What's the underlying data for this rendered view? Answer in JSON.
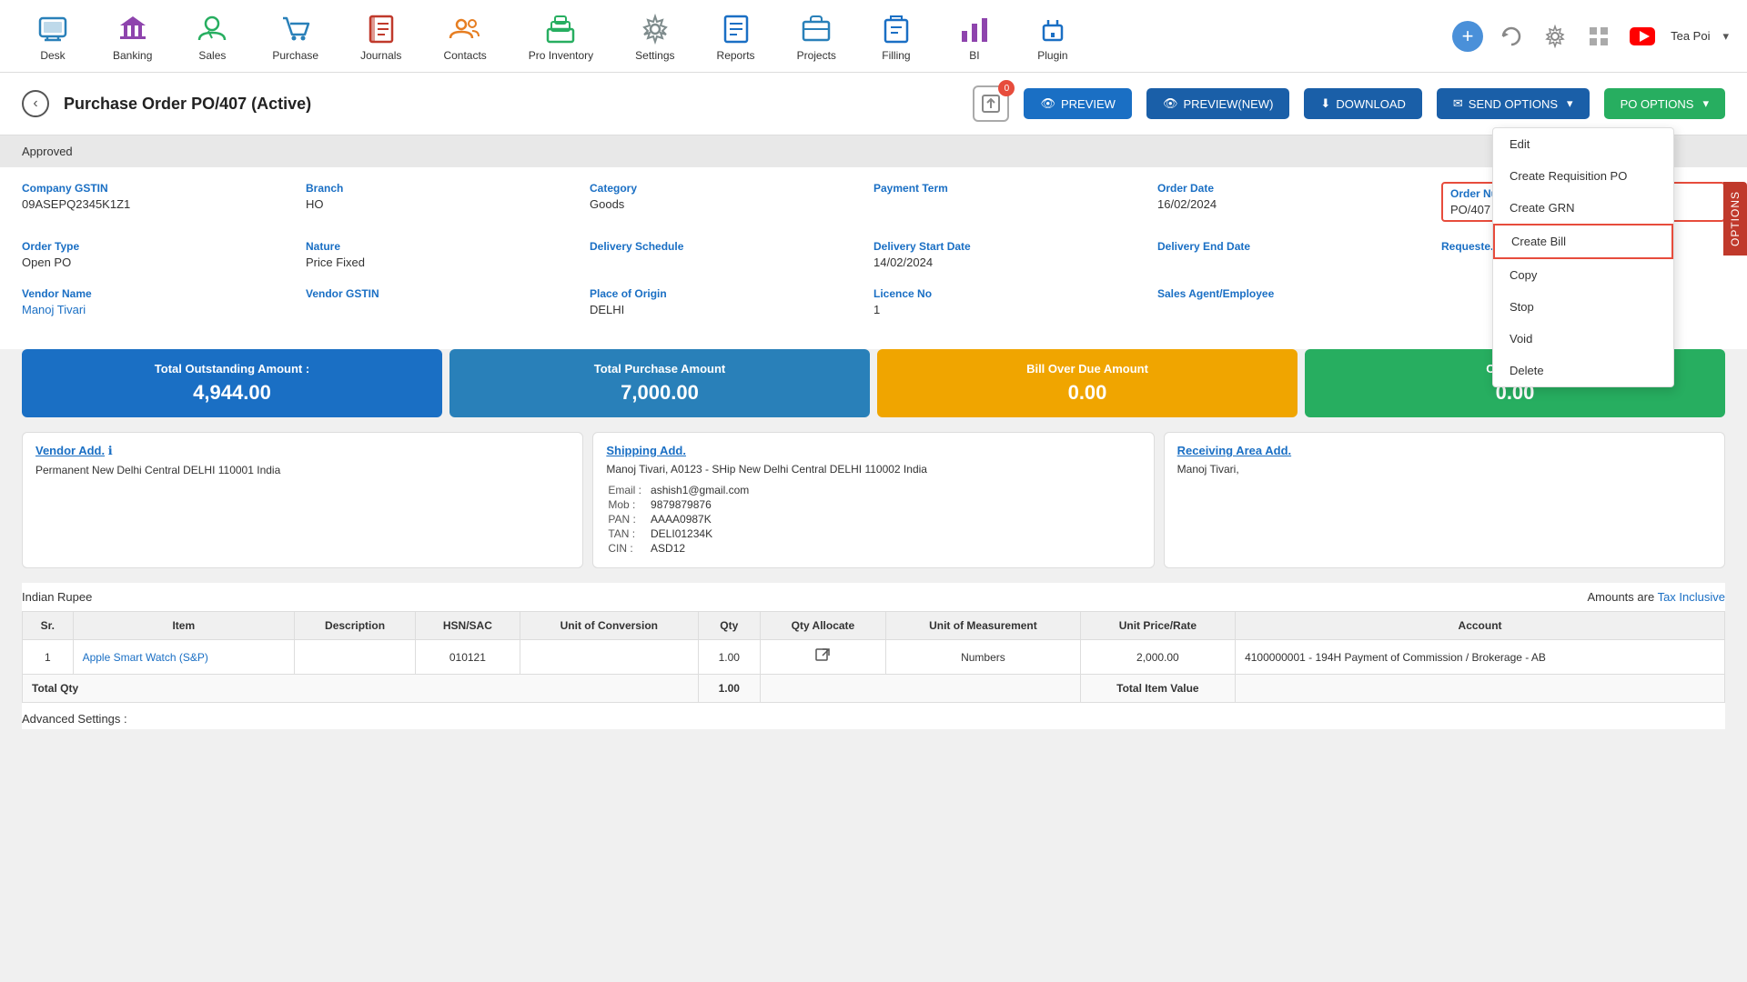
{
  "nav": {
    "items": [
      {
        "id": "desk",
        "label": "Desk",
        "icon": "🏠"
      },
      {
        "id": "banking",
        "label": "Banking",
        "icon": "🏦"
      },
      {
        "id": "sales",
        "label": "Sales",
        "icon": "👤"
      },
      {
        "id": "purchase",
        "label": "Purchase",
        "icon": "🛒"
      },
      {
        "id": "journals",
        "label": "Journals",
        "icon": "📓"
      },
      {
        "id": "contacts",
        "label": "Contacts",
        "icon": "👥"
      },
      {
        "id": "pro_inventory",
        "label": "Pro Inventory",
        "icon": "📦"
      },
      {
        "id": "settings",
        "label": "Settings",
        "icon": "⚙️"
      },
      {
        "id": "reports",
        "label": "Reports",
        "icon": "📊"
      },
      {
        "id": "projects",
        "label": "Projects",
        "icon": "📋"
      },
      {
        "id": "filling",
        "label": "Filling",
        "icon": "🗂️"
      },
      {
        "id": "bi",
        "label": "BI",
        "icon": "📈"
      },
      {
        "id": "plugin",
        "label": "Plugin",
        "icon": "🔌"
      }
    ],
    "user": "Tea Poi"
  },
  "page": {
    "title": "Purchase Order PO/407 (Active)",
    "status": "Approved",
    "badge_count": "0"
  },
  "buttons": {
    "preview": "PREVIEW",
    "preview_new": "PREVIEW(NEW)",
    "download": "DOWNLOAD",
    "send_options": "SEND OPTIONS",
    "po_options": "PO OPTIONS"
  },
  "fields": {
    "company_gstin_label": "Company GSTIN",
    "company_gstin_value": "09ASEPQ2345K1Z1",
    "branch_label": "Branch",
    "branch_value": "HO",
    "category_label": "Category",
    "category_value": "Goods",
    "payment_term_label": "Payment Term",
    "payment_term_value": "",
    "order_date_label": "Order Date",
    "order_date_value": "16/02/2024",
    "order_num_label": "Order Nu...",
    "order_num_value": "PO/407",
    "order_type_label": "Order Type",
    "order_type_value": "Open PO",
    "nature_label": "Nature",
    "nature_value": "Price Fixed",
    "delivery_schedule_label": "Delivery Schedule",
    "delivery_schedule_value": "",
    "delivery_start_label": "Delivery Start Date",
    "delivery_start_value": "14/02/2024",
    "delivery_end_label": "Delivery End Date",
    "delivery_end_value": "",
    "requested_label": "Requeste...",
    "requested_value": "",
    "vendor_name_label": "Vendor Name",
    "vendor_name_value": "Manoj Tivari",
    "vendor_gstin_label": "Vendor GSTIN",
    "vendor_gstin_value": "",
    "place_of_origin_label": "Place of Origin",
    "place_of_origin_value": "DELHI",
    "licence_no_label": "Licence No",
    "licence_no_value": "1",
    "sales_agent_label": "Sales Agent/Employee",
    "sales_agent_value": ""
  },
  "cards": [
    {
      "id": "outstanding",
      "title": "Total Outstanding Amount :",
      "value": "4,944.00",
      "color": "card-blue"
    },
    {
      "id": "purchase",
      "title": "Total Purchase Amount",
      "value": "7,000.00",
      "color": "card-blue2"
    },
    {
      "id": "bill_overdue",
      "title": "Bill Over Due Amount",
      "value": "0.00",
      "color": "card-yellow"
    },
    {
      "id": "credit_limit",
      "title": "Credit Li...",
      "value": "0.00",
      "color": "card-green"
    }
  ],
  "addresses": {
    "vendor": {
      "link_text": "Vendor Add.",
      "text": "Permanent New Delhi Central DELHI 110001 India"
    },
    "shipping": {
      "link_text": "Shipping Add.",
      "line1": "Manoj Tivari, A0123 - SHip New Delhi Central DELHI 110002 India",
      "email_label": "Email :",
      "email_value": "ashish1@gmail.com",
      "mob_label": "Mob :",
      "mob_value": "9879879876",
      "pan_label": "PAN :",
      "pan_value": "AAAA0987K",
      "tan_label": "TAN :",
      "tan_value": "DELI01234K",
      "cin_label": "CIN :",
      "cin_value": "ASD12"
    },
    "receiving": {
      "link_text": "Receiving Area Add.",
      "text": "Manoj Tivari,"
    }
  },
  "table": {
    "currency_label": "Indian Rupee",
    "tax_label": "Amounts are",
    "tax_link": "Tax Inclusive",
    "columns": [
      "Sr.",
      "Item",
      "Description",
      "HSN/SAC",
      "Unit of Conversion",
      "Qty",
      "Qty Allocate",
      "Unit of Measurement",
      "Unit Price/Rate",
      "Account"
    ],
    "rows": [
      {
        "sr": "1",
        "item": "Apple Smart Watch (S&P)",
        "description": "",
        "hsn_sac": "010121",
        "unit_conversion": "",
        "qty": "1.00",
        "qty_allocate": "↗",
        "unit_measurement": "Numbers",
        "unit_price": "2,000.00",
        "account": "4100000001 - 194H Payment of Commission / Brokerage - AB"
      }
    ],
    "total_row": {
      "label": "Total Qty",
      "qty": "1.00",
      "total_label": "Total Item Value",
      "total_value": ""
    }
  },
  "dropdown_menu": {
    "items": [
      {
        "id": "edit",
        "label": "Edit",
        "highlighted": false
      },
      {
        "id": "create_requisition_po",
        "label": "Create Requisition PO",
        "highlighted": false
      },
      {
        "id": "create_grn",
        "label": "Create GRN",
        "highlighted": false
      },
      {
        "id": "create_bill",
        "label": "Create Bill",
        "highlighted": true
      },
      {
        "id": "copy",
        "label": "Copy",
        "highlighted": false
      },
      {
        "id": "stop",
        "label": "Stop",
        "highlighted": false
      },
      {
        "id": "void",
        "label": "Void",
        "highlighted": false
      },
      {
        "id": "delete",
        "label": "Delete",
        "highlighted": false
      }
    ]
  },
  "advanced_settings_label": "Advanced Settings :"
}
